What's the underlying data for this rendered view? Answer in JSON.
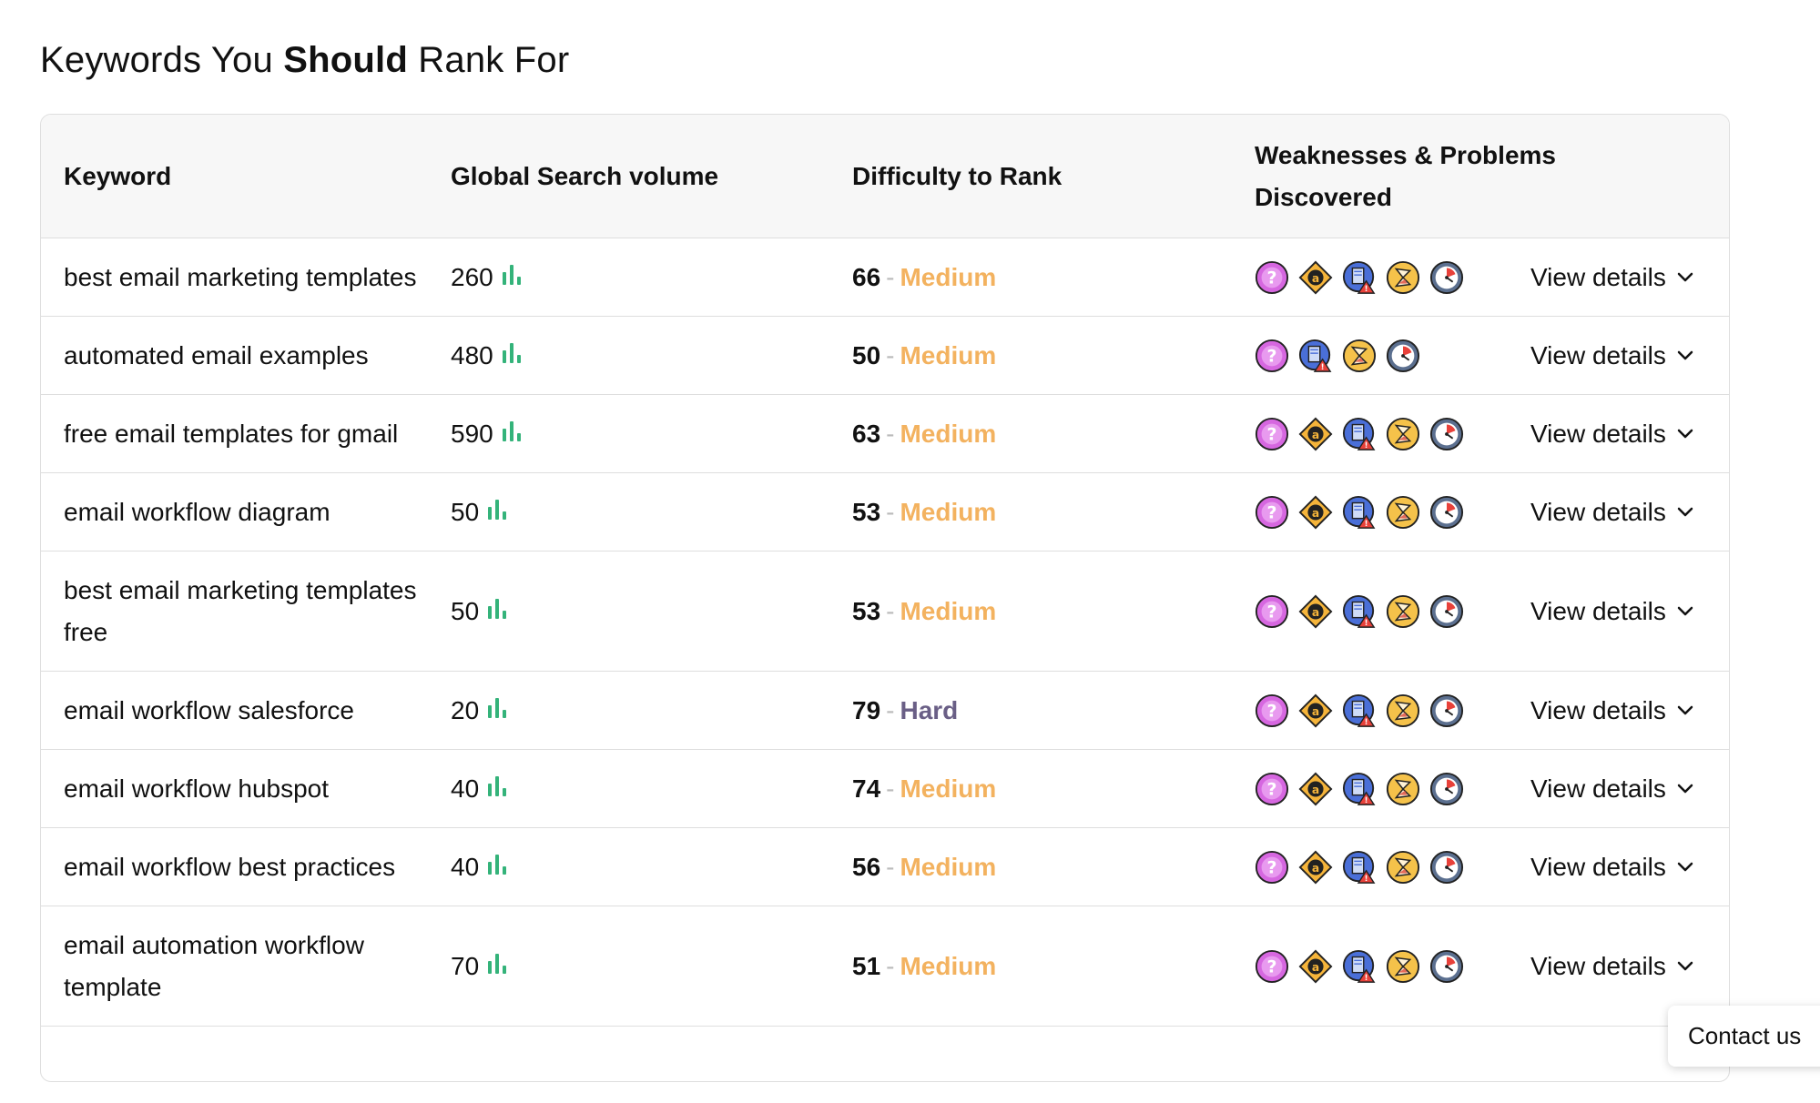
{
  "page": {
    "title_pre": "Keywords You ",
    "title_bold": "Should",
    "title_post": " Rank For"
  },
  "table": {
    "headers": {
      "keyword": "Keyword",
      "volume": "Global Search volume",
      "difficulty": "Difficulty to Rank",
      "weaknesses": "Weaknesses & Problems Discovered"
    },
    "view_details_label": "View details",
    "separator": "-",
    "rows": [
      {
        "keyword": "best email marketing templates",
        "volume": "260",
        "score": "66",
        "level": "Medium",
        "icons": [
          "question-icon",
          "amazon-icon",
          "content-warning-icon",
          "hourglass-icon",
          "clock-icon"
        ]
      },
      {
        "keyword": "automated email examples",
        "volume": "480",
        "score": "50",
        "level": "Medium",
        "icons": [
          "question-icon",
          "content-warning-icon",
          "hourglass-icon",
          "clock-icon"
        ]
      },
      {
        "keyword": "free email templates for gmail",
        "volume": "590",
        "score": "63",
        "level": "Medium",
        "icons": [
          "question-icon",
          "amazon-icon",
          "content-warning-icon",
          "hourglass-icon",
          "clock-icon"
        ]
      },
      {
        "keyword": "email workflow diagram",
        "volume": "50",
        "score": "53",
        "level": "Medium",
        "icons": [
          "question-icon",
          "amazon-icon",
          "content-warning-icon",
          "hourglass-icon",
          "clock-icon"
        ]
      },
      {
        "keyword": "best email marketing templates free",
        "volume": "50",
        "score": "53",
        "level": "Medium",
        "icons": [
          "question-icon",
          "amazon-icon",
          "content-warning-icon",
          "hourglass-icon",
          "clock-icon"
        ]
      },
      {
        "keyword": "email workflow salesforce",
        "volume": "20",
        "score": "79",
        "level": "Hard",
        "icons": [
          "question-icon",
          "amazon-icon",
          "content-warning-icon",
          "hourglass-icon",
          "clock-icon"
        ]
      },
      {
        "keyword": "email workflow hubspot",
        "volume": "40",
        "score": "74",
        "level": "Medium",
        "icons": [
          "question-icon",
          "amazon-icon",
          "content-warning-icon",
          "hourglass-icon",
          "clock-icon"
        ]
      },
      {
        "keyword": "email workflow best practices",
        "volume": "40",
        "score": "56",
        "level": "Medium",
        "icons": [
          "question-icon",
          "amazon-icon",
          "content-warning-icon",
          "hourglass-icon",
          "clock-icon"
        ]
      },
      {
        "keyword": "email automation workflow template",
        "volume": "70",
        "score": "51",
        "level": "Medium",
        "icons": [
          "question-icon",
          "amazon-icon",
          "content-warning-icon",
          "hourglass-icon",
          "clock-icon"
        ]
      }
    ]
  },
  "colors": {
    "medium": "#f3b25f",
    "hard": "#6a5f86",
    "bars": "#34b37a",
    "header_bg": "#f7f7f7",
    "border": "#dedede"
  },
  "contact": {
    "label": "Contact us"
  }
}
